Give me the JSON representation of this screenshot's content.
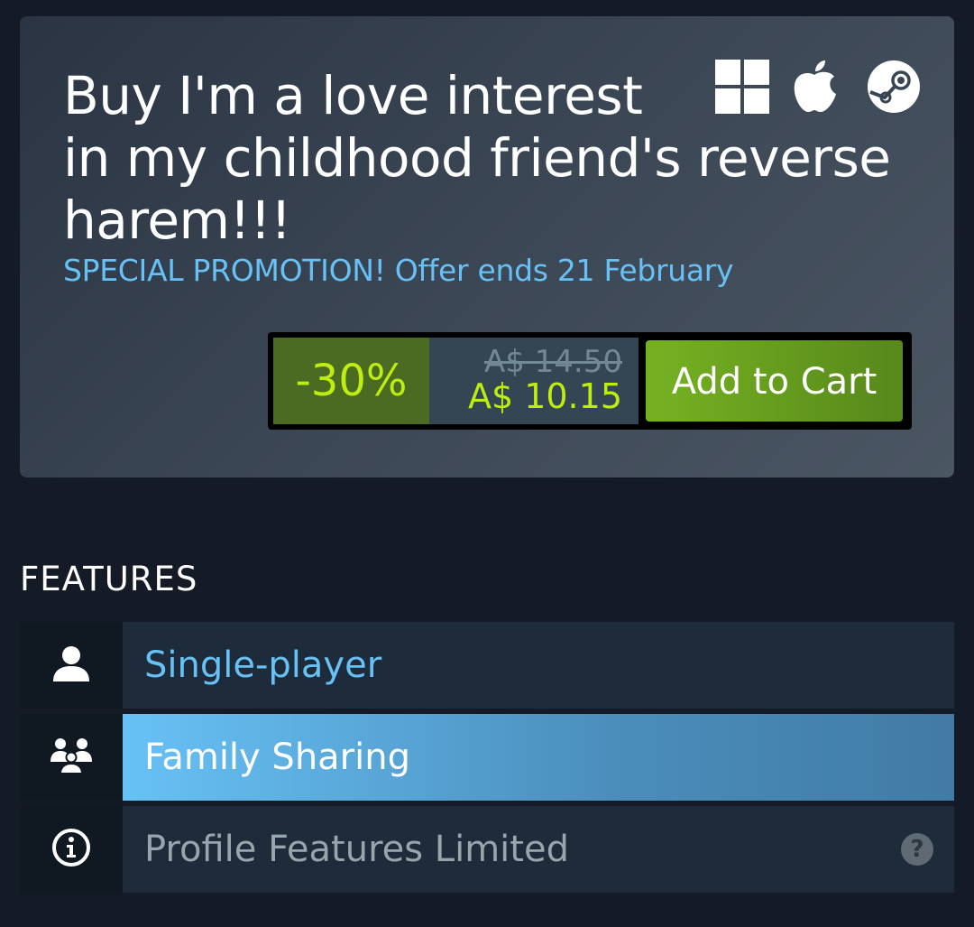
{
  "purchase": {
    "title_lines": [
      "Buy I'm a love interest",
      "in my childhood friend's reverse",
      "harem!!!"
    ],
    "platforms": [
      "windows-icon",
      "apple-icon",
      "steam-icon"
    ],
    "promo_text": "SPECIAL PROMOTION! Offer ends 21 February",
    "discount_pct": "-30%",
    "original_price": "A$ 14.50",
    "final_price": "A$ 10.15",
    "add_to_cart_label": "Add to Cart"
  },
  "features": {
    "heading": "FEATURES",
    "items": [
      {
        "label": "Single-player",
        "icon": "single-player-icon"
      },
      {
        "label": "Family Sharing",
        "icon": "family-sharing-icon"
      },
      {
        "label": "Profile Features Limited",
        "icon": "info-icon",
        "help": "?"
      }
    ]
  },
  "colors": {
    "background": "#151b26",
    "link_blue": "#67c1f5",
    "discount_green": "#beee11",
    "cart_green": "#75b022"
  }
}
